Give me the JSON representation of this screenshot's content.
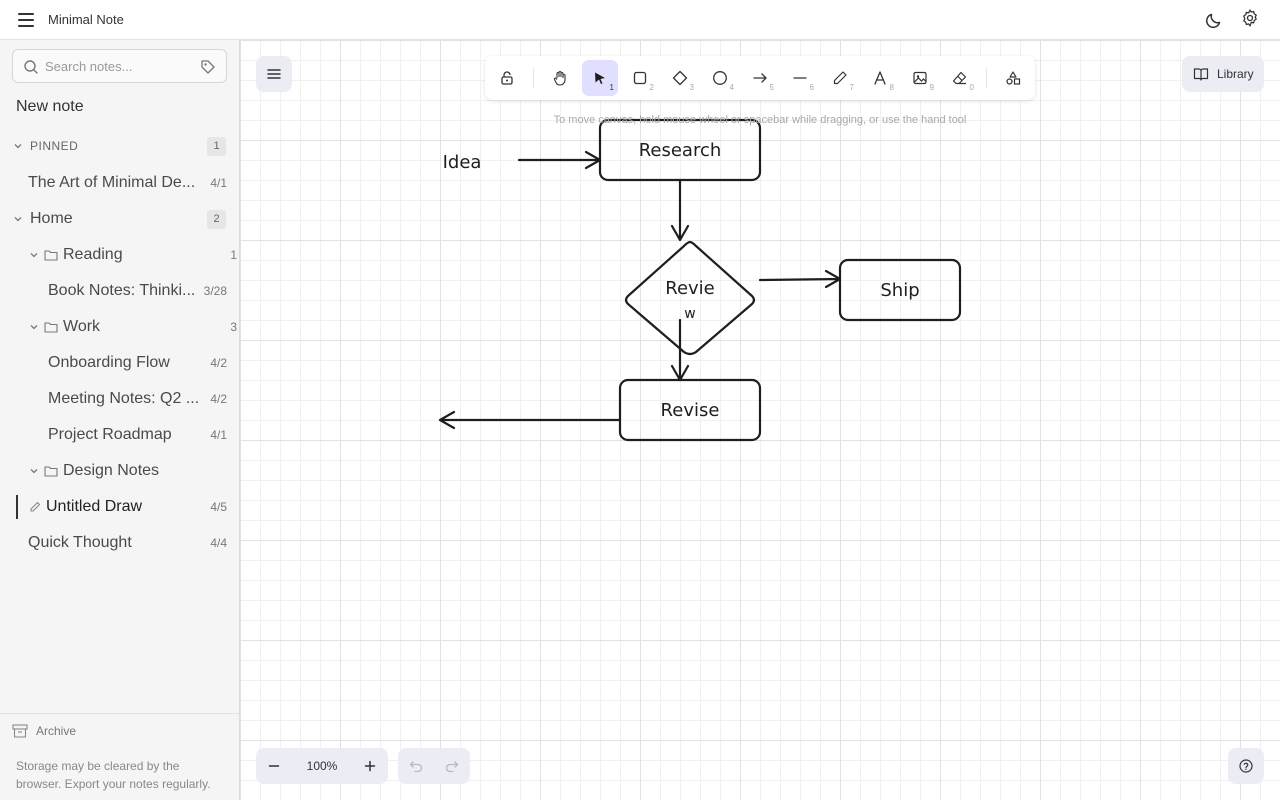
{
  "app": {
    "title": "Minimal Note"
  },
  "sidebar": {
    "search_placeholder": "Search notes...",
    "new_note": "New note",
    "pinned": {
      "label": "PINNED",
      "count": "1"
    },
    "pinned_items": [
      {
        "label": "The Art of Minimal De...",
        "count": "4/1"
      }
    ],
    "home": {
      "label": "Home",
      "count": "2"
    },
    "reading": {
      "label": "Reading",
      "count": "1"
    },
    "reading_items": [
      {
        "label": "Book Notes: Thinki...",
        "count": "3/28"
      }
    ],
    "work": {
      "label": "Work",
      "count": "3"
    },
    "work_items": [
      {
        "label": "Onboarding Flow",
        "count": "4/2"
      },
      {
        "label": "Meeting Notes: Q2 ...",
        "count": "4/2"
      },
      {
        "label": "Project Roadmap",
        "count": "4/1"
      }
    ],
    "design": {
      "label": "Design Notes"
    },
    "design_items": [
      {
        "label": "Untitled Draw",
        "count": "4/5",
        "active": true
      }
    ],
    "root_items": [
      {
        "label": "Quick Thought",
        "count": "4/4"
      }
    ],
    "archive": "Archive",
    "storage_note": "Storage may be cleared by the browser. Export your notes regularly."
  },
  "canvas": {
    "hint": "To move canvas, hold mouse wheel or spacebar while dragging, or use the hand tool",
    "library": "Library",
    "zoom": "100%",
    "toolbar": [
      {
        "name": "lock",
        "key": ""
      },
      {
        "name": "hand",
        "key": ""
      },
      {
        "name": "selection",
        "key": "1",
        "active": true
      },
      {
        "name": "rectangle",
        "key": "2"
      },
      {
        "name": "diamond",
        "key": "3"
      },
      {
        "name": "ellipse",
        "key": "4"
      },
      {
        "name": "arrow",
        "key": "5"
      },
      {
        "name": "line",
        "key": "6"
      },
      {
        "name": "draw",
        "key": "7"
      },
      {
        "name": "text",
        "key": "8"
      },
      {
        "name": "image",
        "key": "9"
      },
      {
        "name": "eraser",
        "key": "0"
      },
      {
        "name": "extra-tools",
        "key": ""
      }
    ],
    "flowchart": {
      "idea": "Idea",
      "research": "Research",
      "review_line1": "Revie",
      "review_line2": "w",
      "ship": "Ship",
      "revise": "Revise"
    }
  },
  "colors": {
    "accent": "#e0dfff",
    "stroke": "#1e1e1e",
    "sidebar_bg": "#f5f5f5"
  }
}
